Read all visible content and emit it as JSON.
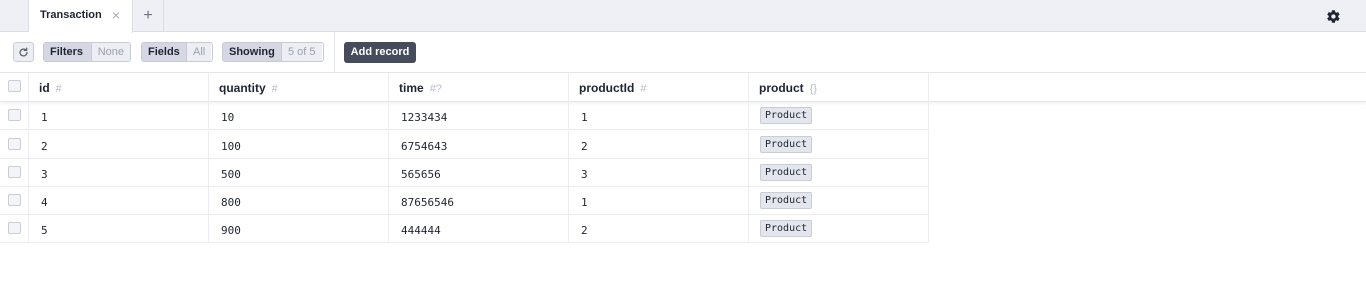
{
  "tabs": [
    {
      "label": "Transaction",
      "close_icon": "close-icon"
    }
  ],
  "add_tab_label": "+",
  "toolbar": {
    "filters_label": "Filters",
    "filters_value": "None",
    "fields_label": "Fields",
    "fields_value": "All",
    "showing_label": "Showing",
    "showing_value": "5 of 5",
    "add_record_label": "Add record"
  },
  "columns": [
    {
      "name": "id",
      "type_glyph": "#"
    },
    {
      "name": "quantity",
      "type_glyph": "#"
    },
    {
      "name": "time",
      "type_glyph": "#?"
    },
    {
      "name": "productId",
      "type_glyph": "#"
    },
    {
      "name": "product",
      "type_glyph": "{}"
    }
  ],
  "rows": [
    {
      "id": "1",
      "quantity": "10",
      "time": "1233434",
      "productId": "1",
      "product": "Product"
    },
    {
      "id": "2",
      "quantity": "100",
      "time": "6754643",
      "productId": "2",
      "product": "Product"
    },
    {
      "id": "3",
      "quantity": "500",
      "time": "565656",
      "productId": "3",
      "product": "Product"
    },
    {
      "id": "4",
      "quantity": "800",
      "time": "87656546",
      "productId": "1",
      "product": "Product"
    },
    {
      "id": "5",
      "quantity": "900",
      "time": "444444",
      "productId": "2",
      "product": "Product"
    }
  ],
  "colors": {
    "accent": "#474c5c",
    "tabbar_bg": "#eef0f6"
  }
}
